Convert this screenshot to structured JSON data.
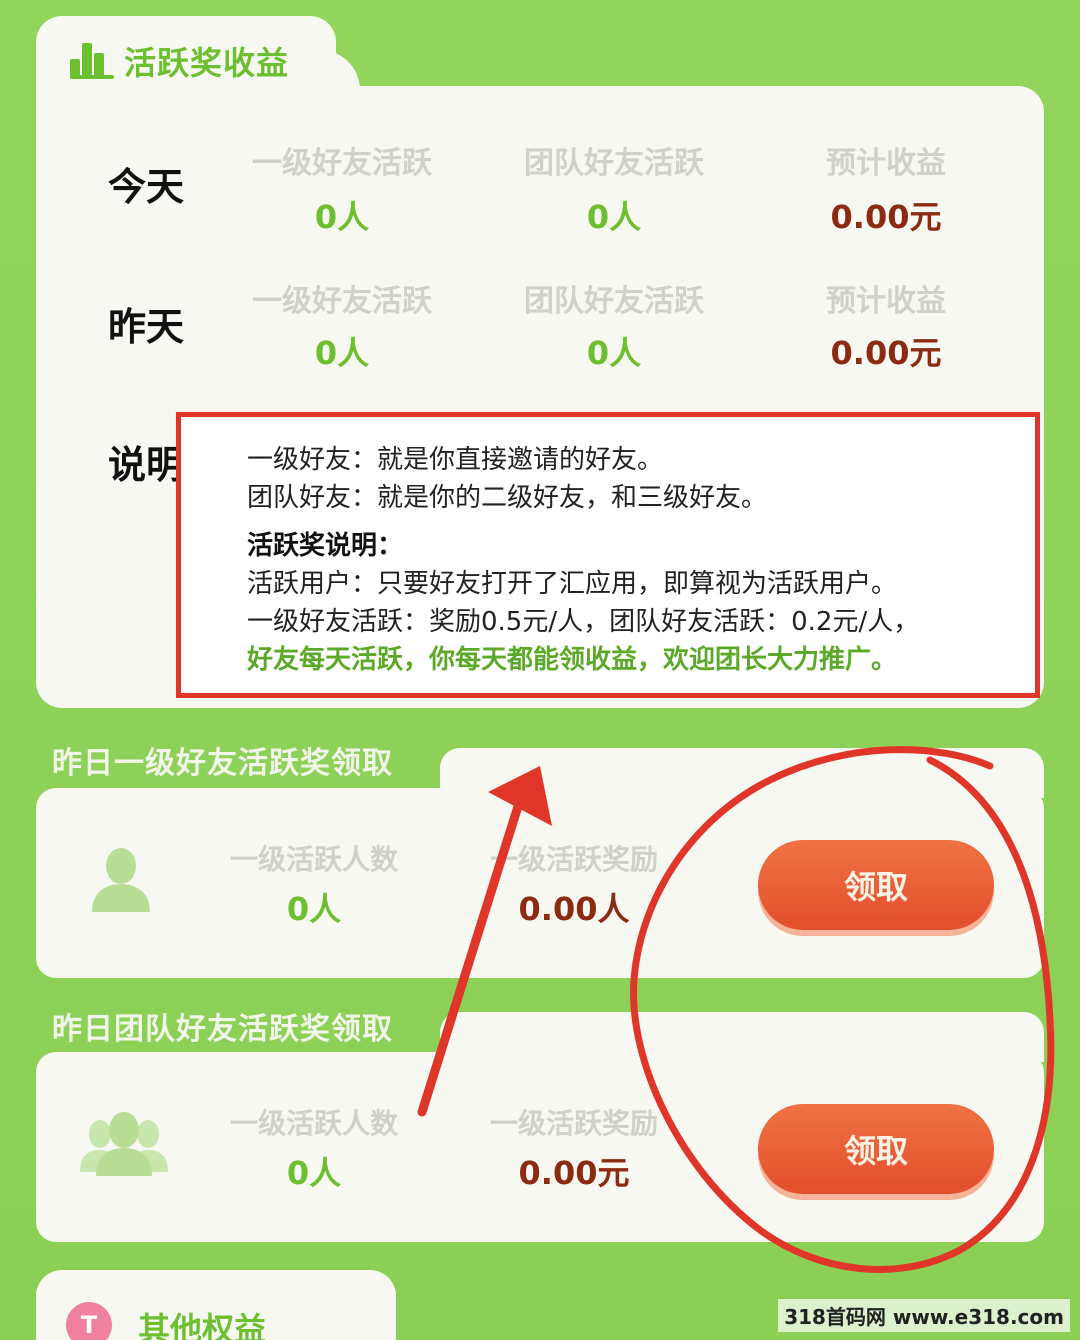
{
  "header": {
    "title": "活跃奖收益",
    "icon": "bar-chart-icon"
  },
  "table": {
    "columns": [
      "一级好友活跃",
      "团队好友活跃",
      "预计收益"
    ],
    "rows": [
      {
        "label": "今天",
        "values": [
          "0人",
          "0人",
          "0.00元"
        ]
      },
      {
        "label": "昨天",
        "values": [
          "0人",
          "0人",
          "0.00元"
        ]
      }
    ],
    "explain_label": "说明"
  },
  "explain": {
    "line1": "一级好友：就是你直接邀请的好友。",
    "line2": "团队好友：就是你的二级好友，和三级好友。",
    "heading": "活跃奖说明：",
    "line3": "活跃用户：只要好友打开了汇应用，即算视为活跃用户。",
    "line4": "一级好友活跃：奖励0.5元/人，团队好友活跃：0.2元/人，",
    "highlight": "好友每天活跃，你每天都能领收益，欢迎团长大力推广。"
  },
  "section1": {
    "title": "昨日一级好友活跃奖领取",
    "icon": "user-icon",
    "head1": "一级活跃人数",
    "head2": "一级活跃奖励",
    "val1": "0人",
    "val2": "0.00人",
    "button": "领取"
  },
  "section2": {
    "title": "昨日团队好友活跃奖领取",
    "icon": "group-icon",
    "head1": "一级活跃人数",
    "head2": "一级活跃奖励",
    "val1": "0人",
    "val2": "0.00元",
    "button": "领取"
  },
  "bottom": {
    "title": "其他权益",
    "badge": "T"
  },
  "watermark": "318首码网 www.e318.com",
  "colors": {
    "accent": "#6cbf2f",
    "button": "#e24f2c",
    "annotation": "#e0362a",
    "value": "#8c2a12"
  }
}
